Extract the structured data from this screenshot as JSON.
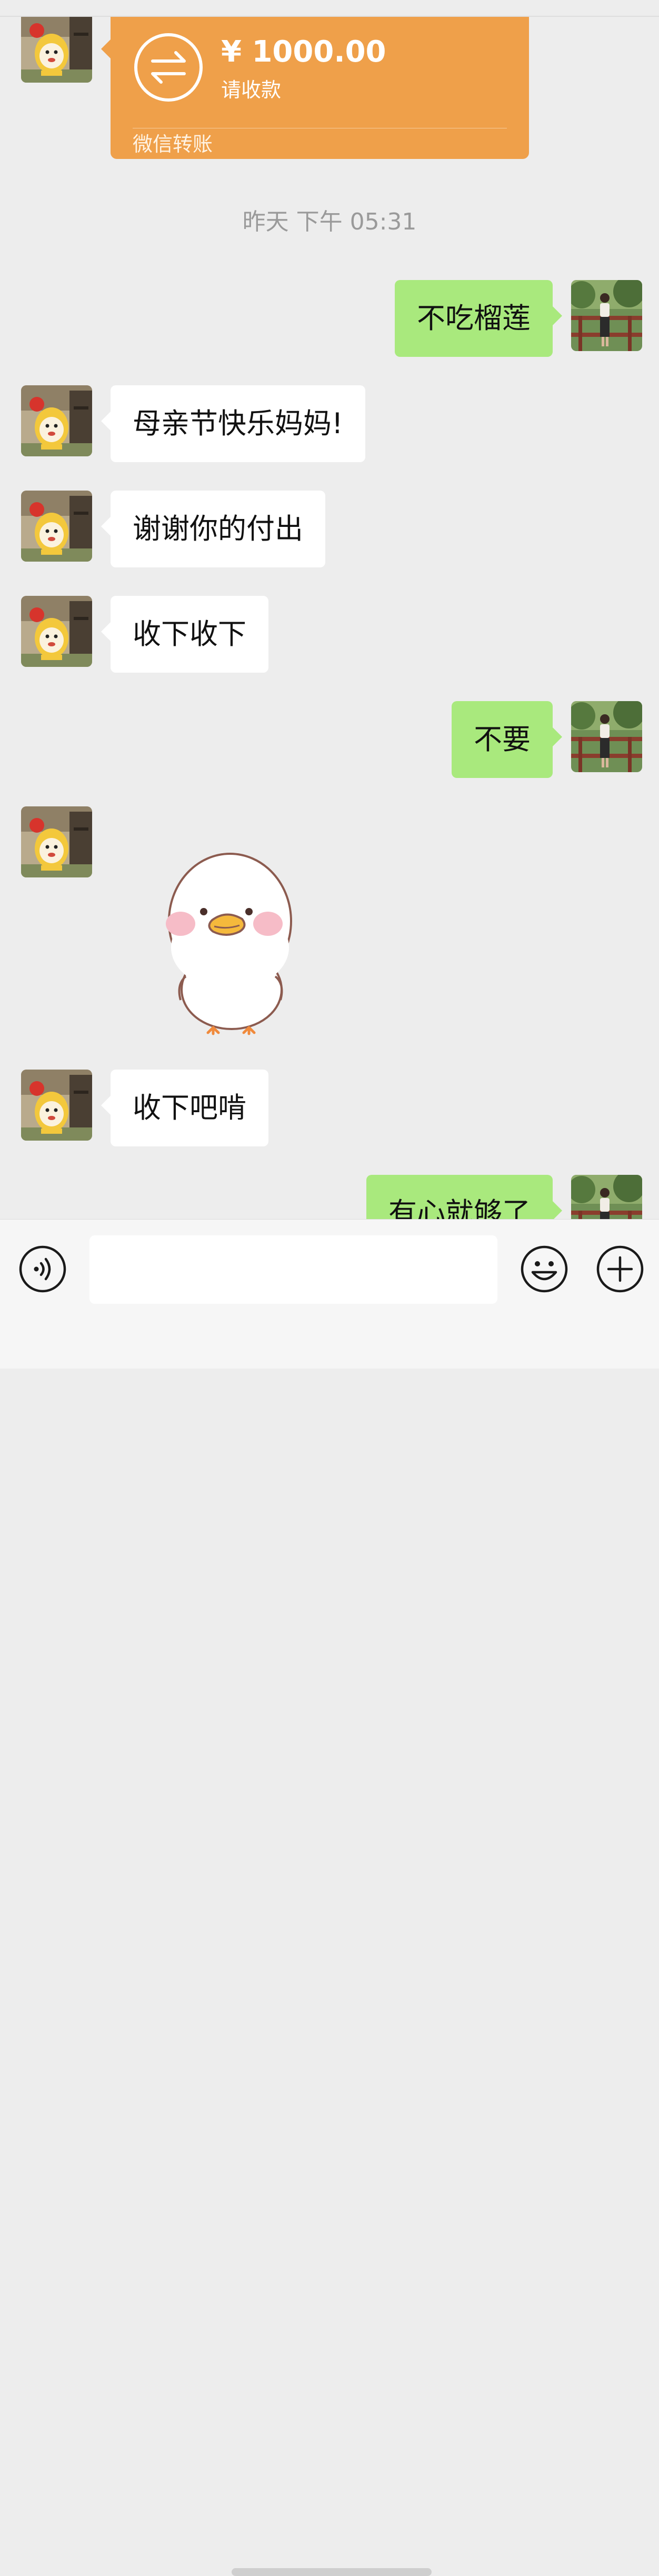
{
  "colors": {
    "background": "#ededed",
    "incoming_bubble": "#ffffff",
    "outgoing_bubble": "#a9e97d",
    "transfer_card": "#efa04a",
    "timestamp_text": "#9a9a9a"
  },
  "transfer": {
    "amount": "¥ 1000.00",
    "status": "请收款",
    "label": "微信转账",
    "icon": "transfer-arrows-icon"
  },
  "timestamp": "昨天 下午 05:31",
  "messages": [
    {
      "sender": "me",
      "text": "不吃榴莲"
    },
    {
      "sender": "contact",
      "text": "母亲节快乐妈妈!"
    },
    {
      "sender": "contact",
      "text": "谢谢你的付出"
    },
    {
      "sender": "contact",
      "text": "收下收下"
    },
    {
      "sender": "me",
      "text": "不要"
    },
    {
      "sender": "contact",
      "type": "sticker",
      "sticker": "white-duck-sticker"
    },
    {
      "sender": "contact",
      "text": "收下吧啃"
    },
    {
      "sender": "me",
      "text": "有心就够了"
    }
  ],
  "input_bar": {
    "voice_icon": "voice-icon",
    "emoji_icon": "emoji-icon",
    "plus_icon": "plus-icon",
    "placeholder": ""
  }
}
